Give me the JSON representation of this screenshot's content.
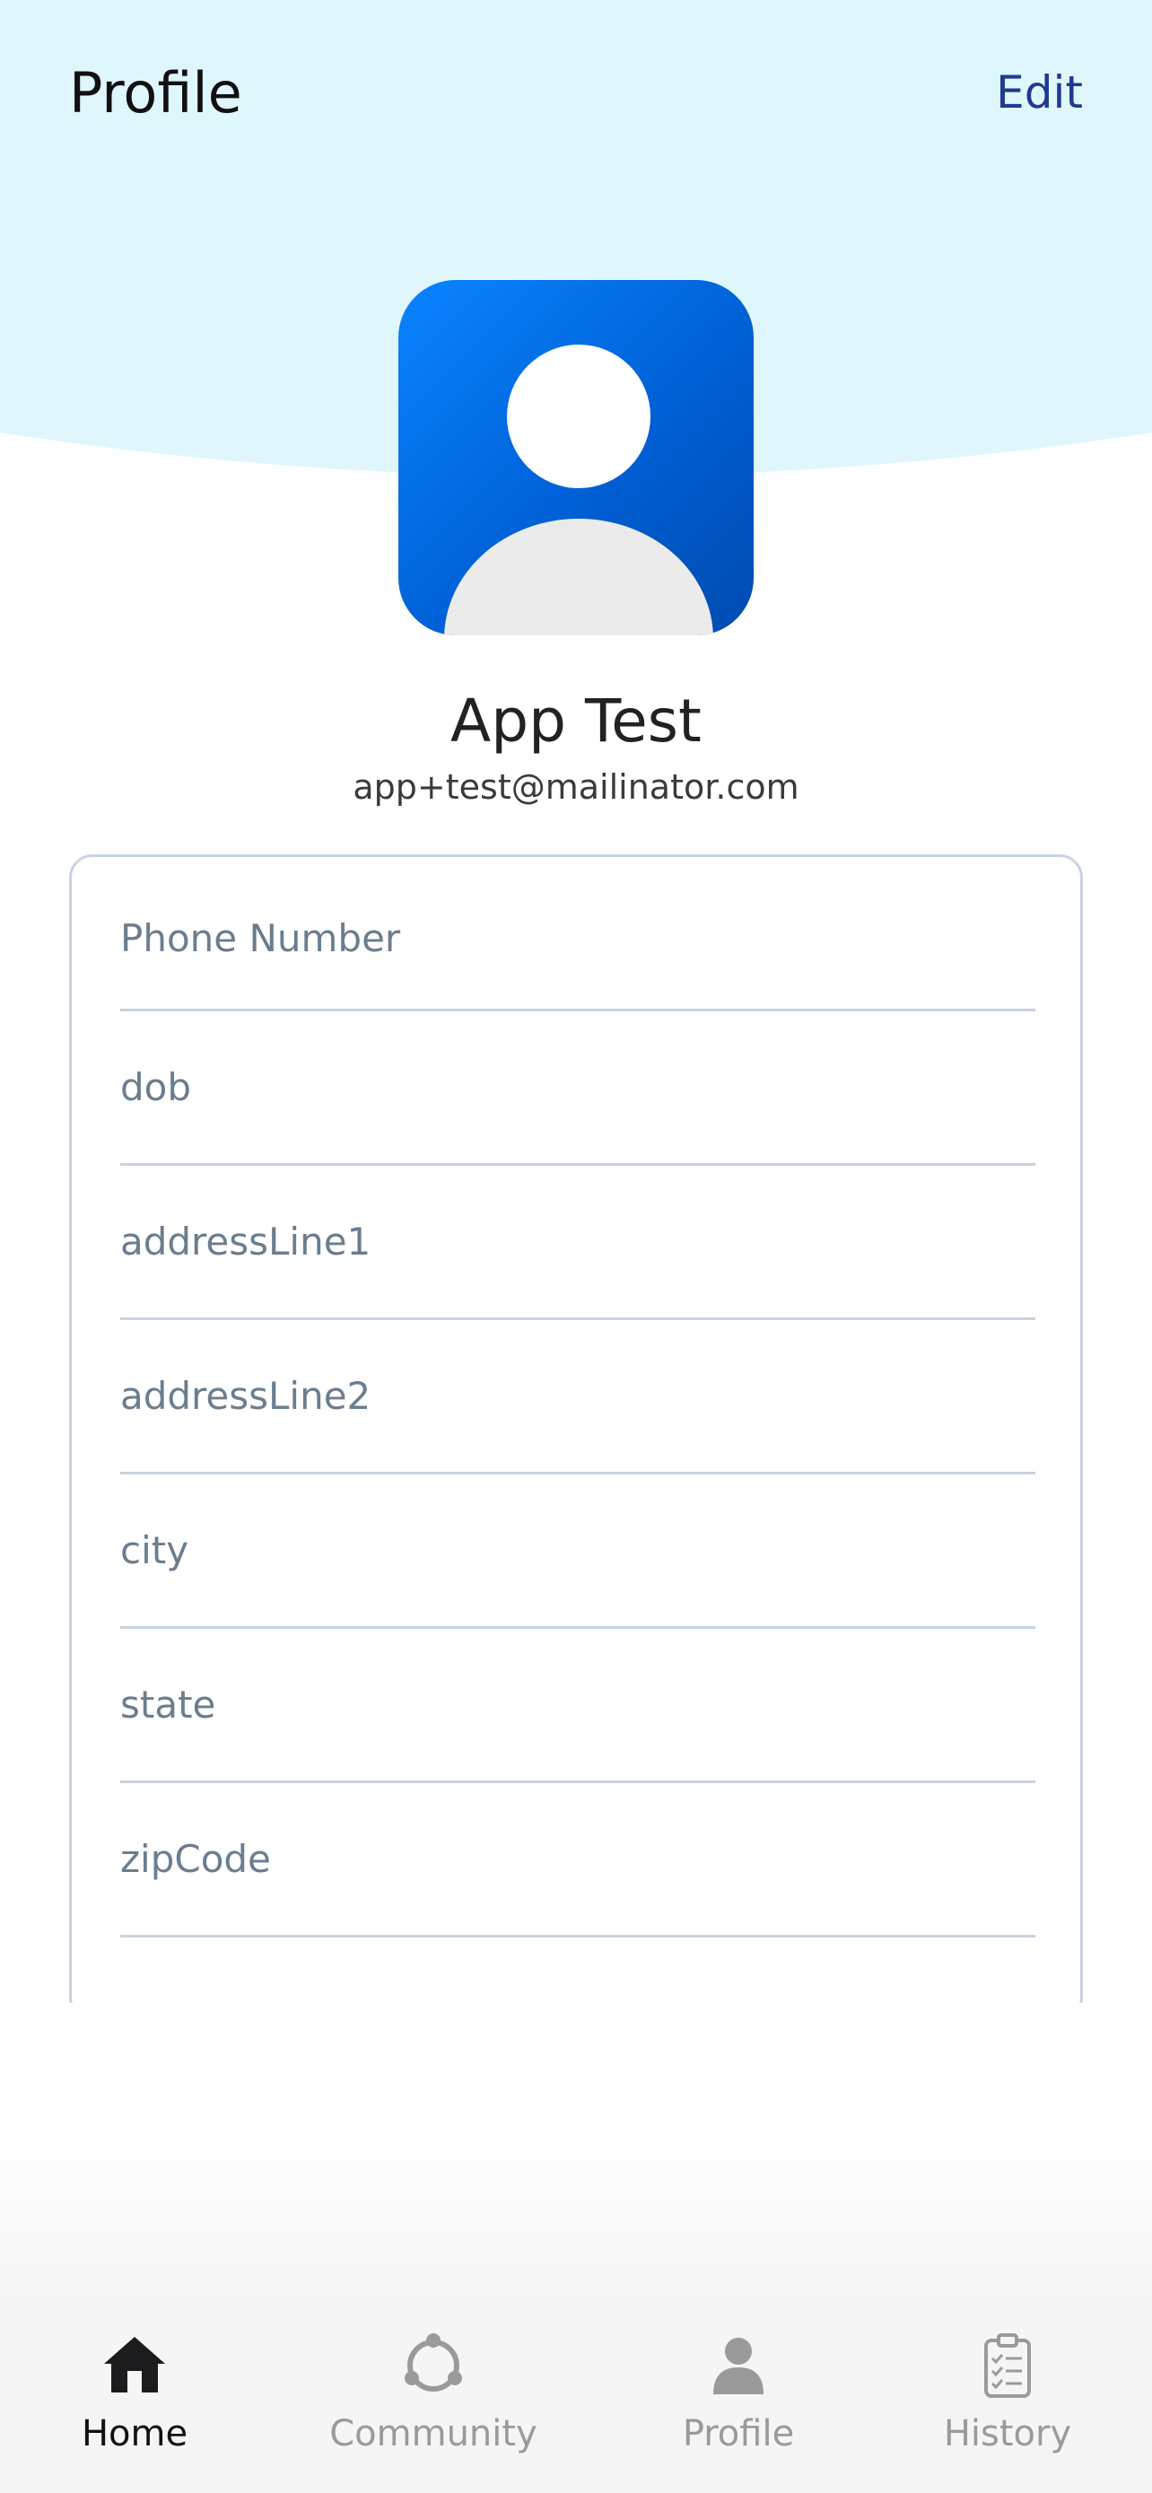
{
  "header": {
    "title": "Profile",
    "edit_label": "Edit"
  },
  "profile": {
    "name": "App Test",
    "email": "app+test@mailinator.com",
    "avatar_icon": "user-avatar-icon"
  },
  "form": {
    "fields": [
      {
        "name": "phone-number-field",
        "placeholder": "Phone Number",
        "value": ""
      },
      {
        "name": "dob-field",
        "placeholder": "dob",
        "value": ""
      },
      {
        "name": "address-line1-field",
        "placeholder": "addressLine1",
        "value": ""
      },
      {
        "name": "address-line2-field",
        "placeholder": "addressLine2",
        "value": ""
      },
      {
        "name": "city-field",
        "placeholder": "city",
        "value": ""
      },
      {
        "name": "state-field",
        "placeholder": "state",
        "value": ""
      },
      {
        "name": "zipcode-field",
        "placeholder": "zipCode",
        "value": ""
      }
    ]
  },
  "tabbar": {
    "tabs": [
      {
        "label": "Home",
        "icon": "home-icon",
        "active": true
      },
      {
        "label": "Community",
        "icon": "community-icon",
        "active": false
      },
      {
        "label": "Profile",
        "icon": "profile-icon",
        "active": false
      },
      {
        "label": "History",
        "icon": "history-icon",
        "active": false
      }
    ]
  },
  "colors": {
    "hero_background": "#e0f6fd",
    "accent": "#1f3b8f",
    "avatar_gradient_start": "#0a84ff",
    "avatar_gradient_end": "#004bb0",
    "field_border": "#c8d3df",
    "placeholder_text": "#6b7d8e",
    "tab_active": "#111111",
    "tab_inactive": "#9a9a9a"
  }
}
